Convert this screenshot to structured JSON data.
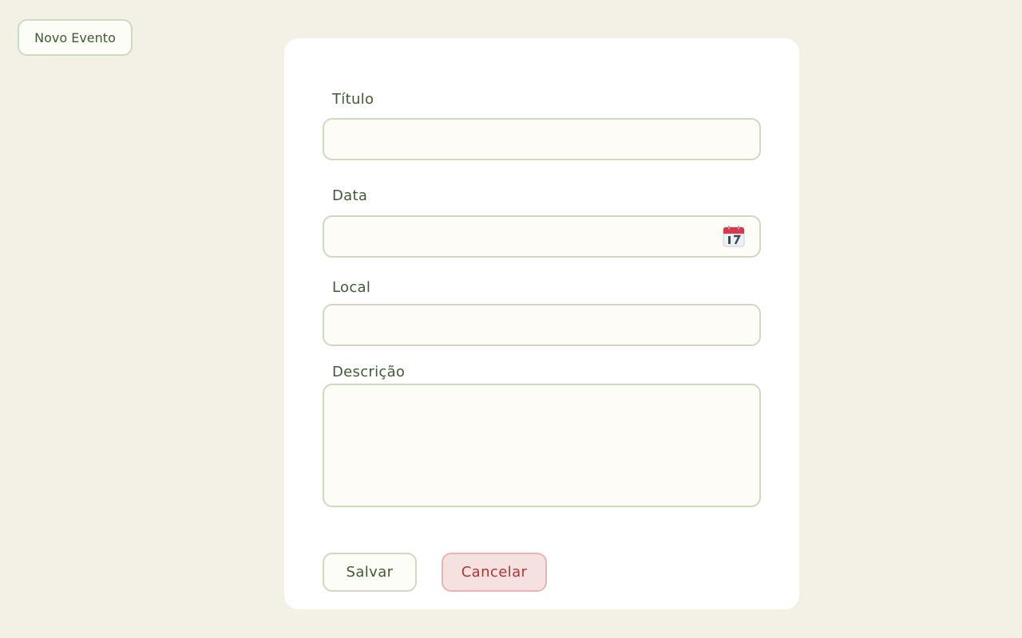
{
  "header": {
    "new_event_label": "Novo Evento"
  },
  "form": {
    "title_label": "Título",
    "title_value": "",
    "date_label": "Data",
    "date_value": "",
    "date_icon": "calendar-icon",
    "location_label": "Local",
    "location_value": "",
    "description_label": "Descrição",
    "description_value": ""
  },
  "actions": {
    "save_label": "Salvar",
    "cancel_label": "Cancelar"
  },
  "colors": {
    "background": "#f3f1e6",
    "card": "#ffffff",
    "text_green": "#3f5a35",
    "field_border": "#cfd8c0",
    "cancel_text": "#b03535",
    "cancel_bg": "#f6e1e1"
  }
}
